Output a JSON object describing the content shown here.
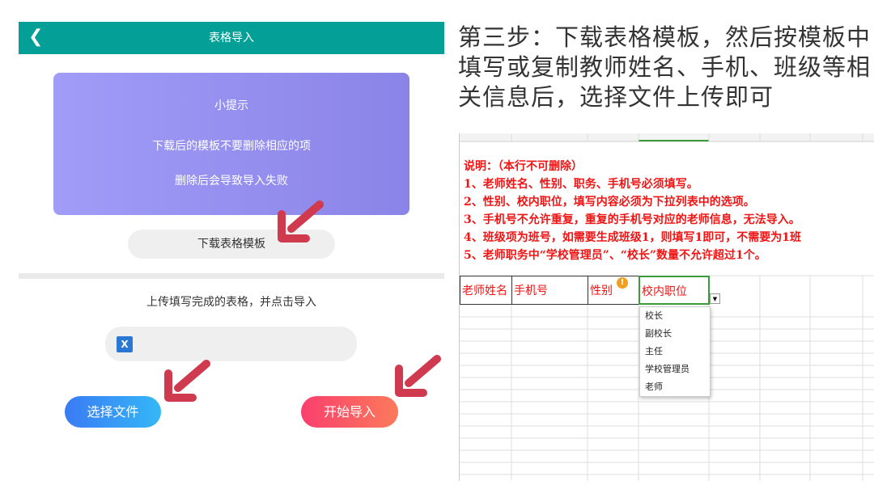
{
  "header": {
    "title": "表格导入"
  },
  "tip": {
    "title": "小提示",
    "line1": "下载后的模板不要删除相应的项",
    "line2": "删除后会导致导入失败"
  },
  "download_button": "下载表格模板",
  "upload_hint": "上传填写完成的表格，并点击导入",
  "select_file_button": "选择文件",
  "start_import_button": "开始导入",
  "instruction": "第三步：下载表格模板，然后按模板中填写或复制教师姓名、手机、班级等相关信息后，选择文件上传即可",
  "sheet": {
    "notes": [
      "说明：（本行不可删除）",
      "1、老师姓名、性别、职务、手机号必须填写。",
      "2、性别、校内职位，填写内容必须为下拉列表中的选项。",
      "3、手机号不允许重复，重复的手机号对应的老师信息，无法导入。",
      "4、班级项为班号，如需要生成班级1，则填写1即可，不需要为1班",
      "5、老师职务中“学校管理员”、“校长”数量不允许超过1个。"
    ],
    "headers": [
      "老师姓名",
      "手机号",
      "性别",
      "校内职位"
    ],
    "dropdown": [
      "校长",
      "副校长",
      "主任",
      "学校管理员",
      "老师"
    ]
  },
  "colors": {
    "teal": "#049f97",
    "red": "#f01414",
    "arrow": "#d03a4f"
  }
}
